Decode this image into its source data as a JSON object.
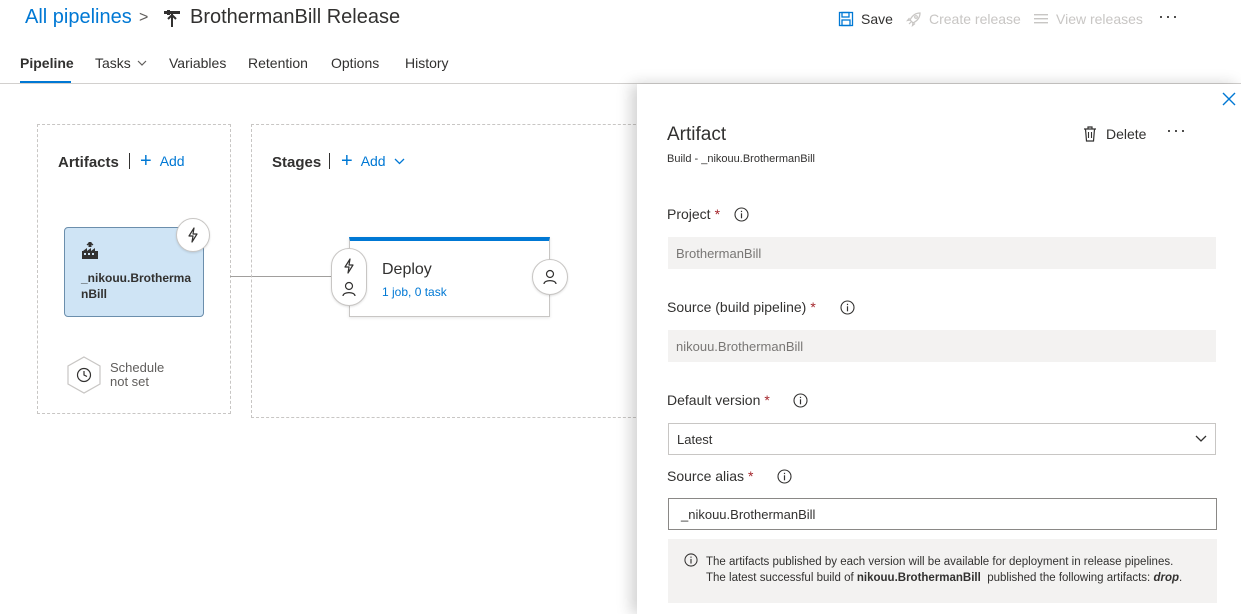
{
  "header": {
    "breadcrumb_root": "All pipelines",
    "separator": ">",
    "pipeline_name": "BrothermanBill Release",
    "actions": {
      "save": "Save",
      "create_release": "Create release",
      "view_releases": "View releases",
      "more": "···"
    }
  },
  "tabs": [
    {
      "label": "Pipeline",
      "active": true
    },
    {
      "label": "Tasks",
      "active": false
    },
    {
      "label": "Variables",
      "active": false
    },
    {
      "label": "Retention",
      "active": false
    },
    {
      "label": "Options",
      "active": false
    },
    {
      "label": "History",
      "active": false
    }
  ],
  "artifacts": {
    "title": "Artifacts",
    "add_label": "Add",
    "artifact_name": "_nikouu.BrothermanBill",
    "schedule_text": "Schedule not set"
  },
  "stages": {
    "title": "Stages",
    "add_label": "Add",
    "stage": {
      "name": "Deploy",
      "summary": "1 job, 0 task"
    }
  },
  "panel": {
    "title": "Artifact",
    "subtitle": "Build - _nikouu.BrothermanBill",
    "delete_label": "Delete",
    "more": "···",
    "fields": {
      "project": {
        "label": "Project",
        "required": "*",
        "value": "BrothermanBill"
      },
      "source": {
        "label": "Source (build pipeline)",
        "required": "*",
        "value": "nikouu.BrothermanBill"
      },
      "default_version": {
        "label": "Default version",
        "required": "*",
        "value": "Latest"
      },
      "source_alias": {
        "label": "Source alias",
        "required": "*",
        "value": "_nikouu.BrothermanBill"
      }
    },
    "info": {
      "line1": "The artifacts published by each version will be available for deployment in release pipelines.",
      "line2_prefix": "The latest successful build of",
      "line2_bold": "nikouu.BrothermanBill",
      "line2_mid": "published the following artifacts:",
      "line2_artifact": "drop",
      "line2_end": "."
    }
  },
  "colors": {
    "accent": "#0078d4",
    "artifact_card_bg": "#cfe4f5",
    "disabled_text": "#c8c6c4",
    "required": "#a4262c"
  },
  "icons": {
    "pipeline": "release-pipeline-icon",
    "save": "save-icon",
    "create_release": "rocket-icon",
    "view_releases": "list-icon",
    "build": "build-icon",
    "trigger": "lightning-icon",
    "schedule": "clock-icon",
    "approver": "person-icon",
    "delete": "trash-icon",
    "info": "info-icon",
    "close": "close-icon",
    "dropdown": "chevron-down-icon"
  }
}
